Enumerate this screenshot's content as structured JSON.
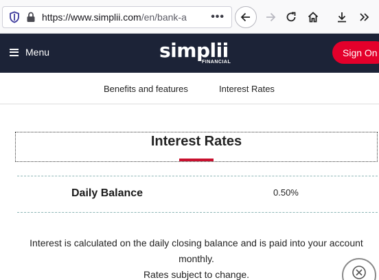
{
  "browser": {
    "url_host": "https://www.simplii.com",
    "url_path": "/en/bank-a",
    "icons": [
      "shield-icon",
      "lock-icon",
      "more-icon",
      "back-icon",
      "forward-icon",
      "reload-icon",
      "home-icon",
      "download-icon",
      "overflow-icon"
    ]
  },
  "header": {
    "menu_label": "Menu",
    "logo_text": "simplii",
    "logo_subtext": "FINANCIAL",
    "signon_label": "Sign On",
    "colors": {
      "background": "#1c2337",
      "accent": "#e4002b"
    }
  },
  "tabs": [
    {
      "label": "Benefits and features"
    },
    {
      "label": "Interest Rates"
    }
  ],
  "main": {
    "title": "Interest Rates",
    "rates": [
      {
        "label": "Daily Balance",
        "value": "0.50%"
      }
    ],
    "note_line1": "Interest is calculated on the daily closing balance and is paid into your account monthly.",
    "note_line2": "Rates subject to change."
  },
  "chat": {
    "icon": "chat-icon"
  }
}
